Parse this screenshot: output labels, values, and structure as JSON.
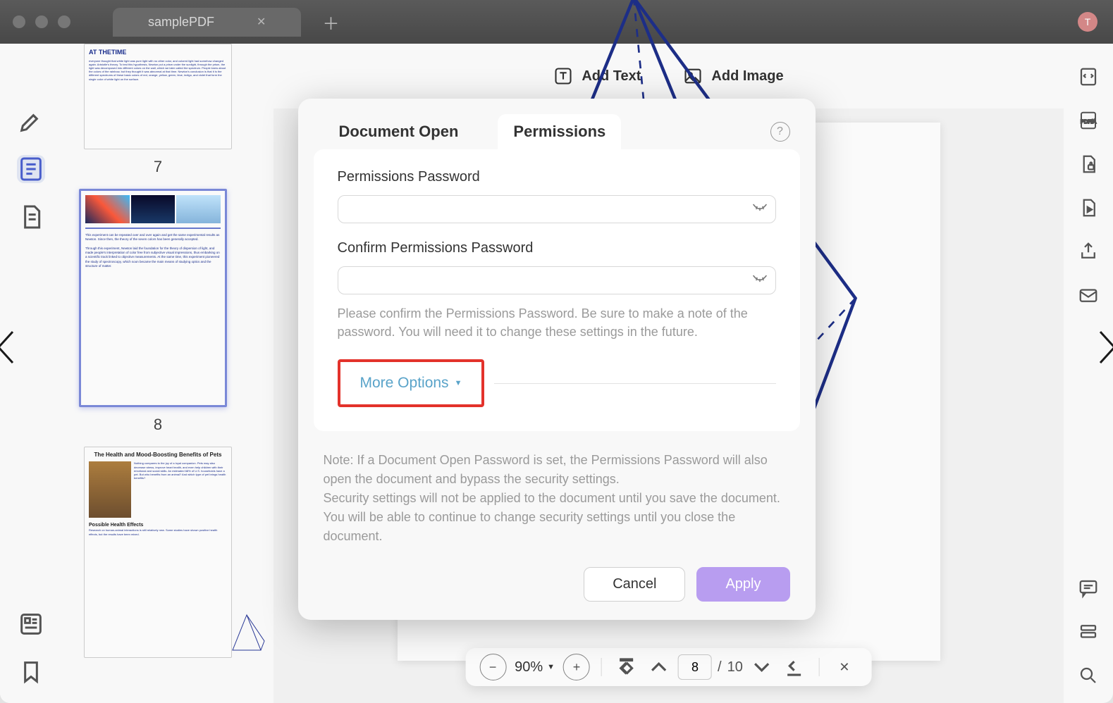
{
  "titlebar": {
    "tab_title": "samplePDF",
    "avatar_letter": "T"
  },
  "toolbar": {
    "add_text": "Add Text",
    "add_image": "Add Image"
  },
  "thumbnails": {
    "page7_label": "7",
    "page8_label": "8",
    "page7_title": "AT THETIME",
    "page9_title": "The Health and Mood-Boosting Benefits of Pets",
    "page9_sub": "Possible Health Effects"
  },
  "page_controls": {
    "zoom": "90%",
    "current_page": "8",
    "sep": "/",
    "total_pages": "10"
  },
  "page_text": {
    "line1": "means of studying optics and the",
    "line2": "structure of matter."
  },
  "modal": {
    "tab_doc_open": "Document Open",
    "tab_permissions": "Permissions",
    "perm_pw_label": "Permissions Password",
    "confirm_pw_label": "Confirm Permissions Password",
    "help_text": "Please confirm the Permissions Password. Be sure to make a note of the password. You will need it to change these settings in the future.",
    "more_options": "More Options",
    "note1": "Note: If a Document Open Password is set, the Permissions Password will also open the document and bypass the security settings.",
    "note2": "Security settings will not be applied to the document until you save the document. You will be able to continue to change security settings until you close the document.",
    "cancel": "Cancel",
    "apply": "Apply"
  }
}
